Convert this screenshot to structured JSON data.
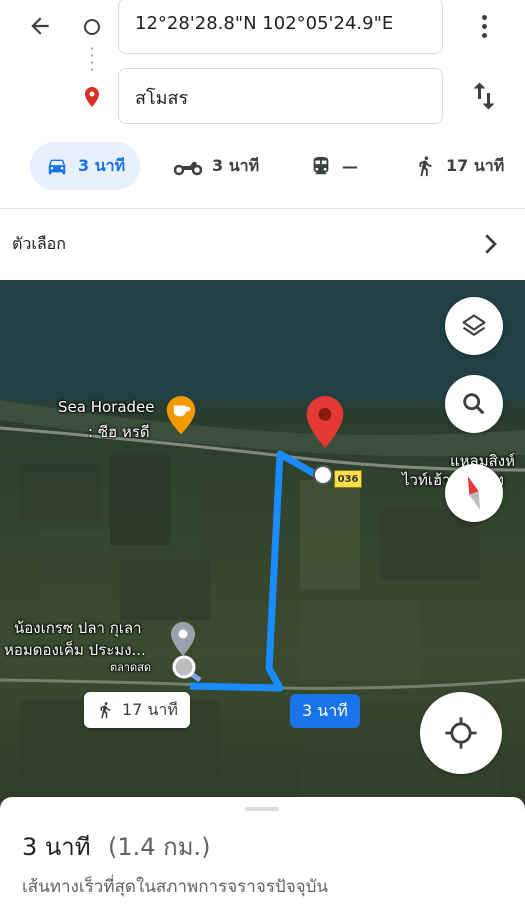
{
  "header": {
    "origin": "12°28'28.8\"N 102°05'24.9\"E",
    "destination": "สโมสร"
  },
  "modes": {
    "car": "3 นาที",
    "bike": "3 นาที",
    "transit": "—",
    "walk": "17 นาที"
  },
  "options_label": "ตัวเลือก",
  "map": {
    "poi_name": "Sea Horadee",
    "poi_subname": ": ซีฮ หรดี",
    "cape_line1": "แหลมสิงห์",
    "cape_line2": "ไวท์เฮ้าส์รีสอร์ท",
    "fish_line1": "น้องเกรซ ปลา กุเลา",
    "fish_line2": "หอมดองเค็ม ประมง...",
    "market": "ตลาดสด",
    "road_number": "036",
    "walk_chip": "17 นาที",
    "car_chip": "3 นาที",
    "route_color": "#1a8cff"
  },
  "sheet": {
    "duration": "3 นาที",
    "distance": "(1.4 กม.)",
    "description": "เส้นทางเร็วที่สุดในสภาพการจราจรปัจจุบัน"
  }
}
